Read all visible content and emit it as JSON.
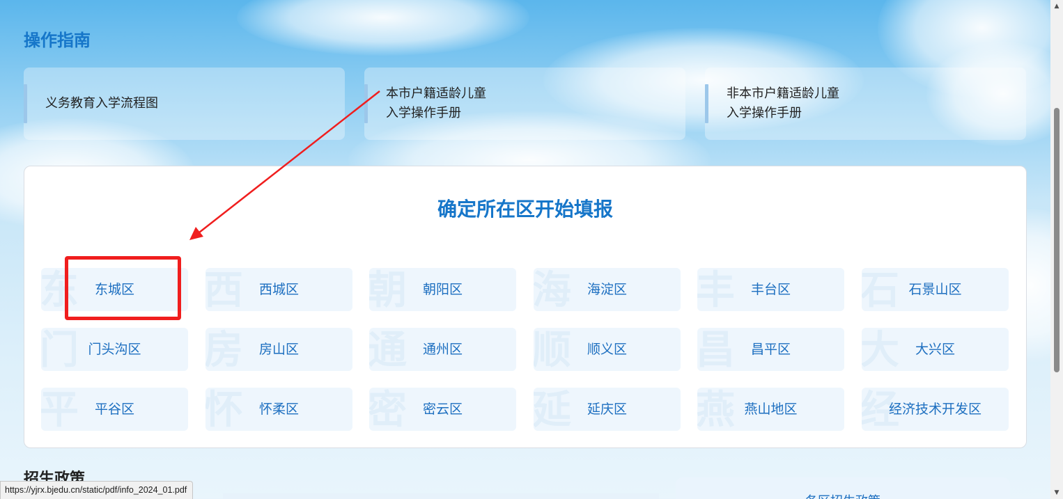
{
  "guide": {
    "title": "操作指南",
    "cards": [
      {
        "line1": "义务教育入学流程图",
        "line2": ""
      },
      {
        "line1": "本市户籍适龄儿童",
        "line2": "入学操作手册"
      },
      {
        "line1": "非本市户籍适龄儿童",
        "line2": "入学操作手册"
      }
    ]
  },
  "district_panel": {
    "title": "确定所在区开始填报",
    "districts": [
      {
        "label": "东城区",
        "watermark": "东"
      },
      {
        "label": "西城区",
        "watermark": "西"
      },
      {
        "label": "朝阳区",
        "watermark": "朝"
      },
      {
        "label": "海淀区",
        "watermark": "海"
      },
      {
        "label": "丰台区",
        "watermark": "丰"
      },
      {
        "label": "石景山区",
        "watermark": "石"
      },
      {
        "label": "门头沟区",
        "watermark": "门"
      },
      {
        "label": "房山区",
        "watermark": "房"
      },
      {
        "label": "通州区",
        "watermark": "通"
      },
      {
        "label": "顺义区",
        "watermark": "顺"
      },
      {
        "label": "昌平区",
        "watermark": "昌"
      },
      {
        "label": "大兴区",
        "watermark": "大"
      },
      {
        "label": "平谷区",
        "watermark": "平"
      },
      {
        "label": "怀柔区",
        "watermark": "怀"
      },
      {
        "label": "密云区",
        "watermark": "密"
      },
      {
        "label": "延庆区",
        "watermark": "延"
      },
      {
        "label": "燕山地区",
        "watermark": "燕"
      },
      {
        "label": "经济技术开发区",
        "watermark": "经"
      }
    ]
  },
  "policy": {
    "title": "招生政策",
    "card_label": "各区招生政策"
  },
  "status_bar": {
    "url": "https://yjrx.bjedu.cn/static/pdf/info_2024_01.pdf"
  },
  "annotation": {
    "color": "#f01e1e",
    "highlighted_district": "东城区"
  },
  "colors": {
    "accent": "#1676c9",
    "district_text": "#1d6fc0",
    "district_bg": "#eef6fd"
  }
}
